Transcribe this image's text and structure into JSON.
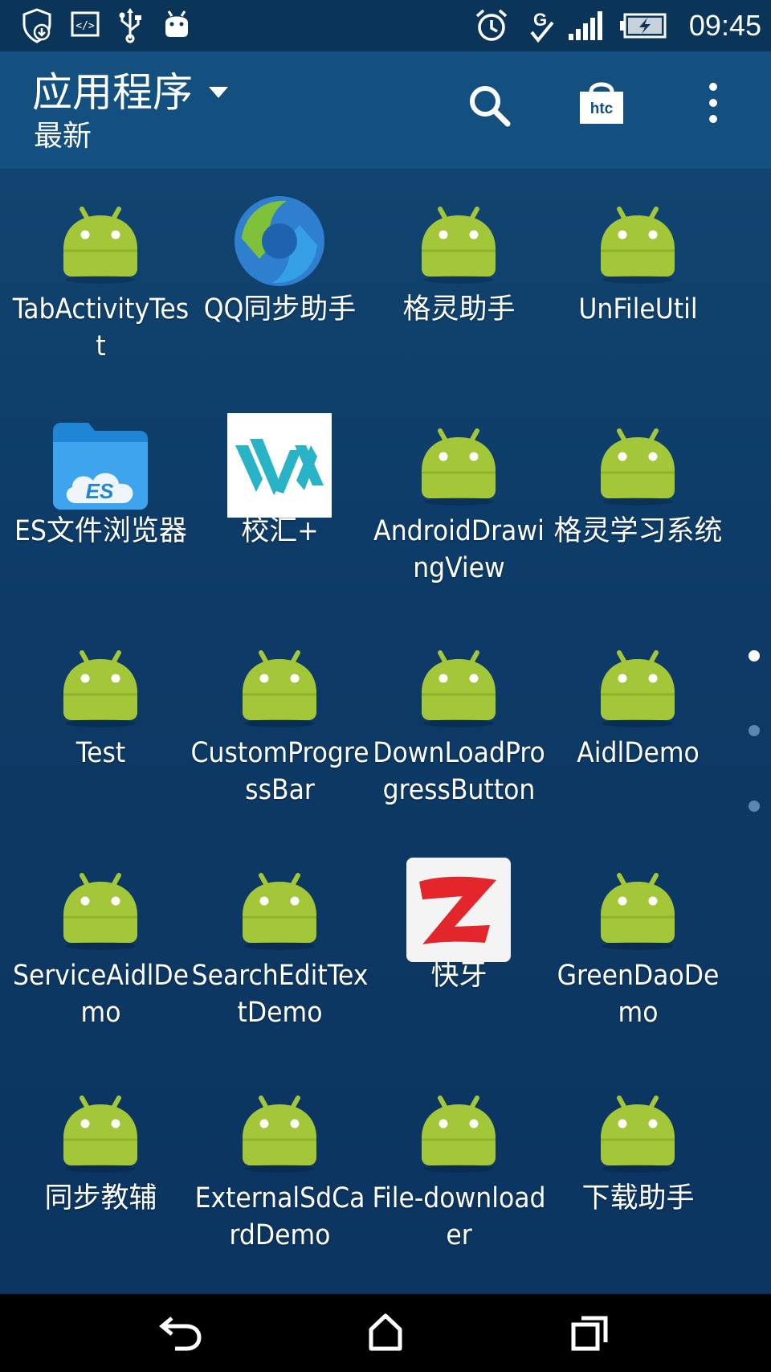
{
  "status_bar": {
    "time": "09:45",
    "left_icons": [
      "shield-download-icon",
      "code-icon",
      "usb-icon",
      "android-debug-icon"
    ],
    "right_icons": [
      "alarm-icon",
      "g-signal-icon",
      "cell-signal-icon",
      "battery-charging-icon"
    ]
  },
  "app_bar": {
    "title": "应用程序",
    "subtitle": "最新",
    "actions": [
      "search-icon",
      "htc-store-icon",
      "more-vert-icon"
    ]
  },
  "apps": [
    {
      "label": "TabActivityTest",
      "icon": "android-icon"
    },
    {
      "label": "QQ同步助手",
      "icon": "qq-sync-icon"
    },
    {
      "label": "格灵助手",
      "icon": "android-icon"
    },
    {
      "label": "UnFileUtil",
      "icon": "android-icon"
    },
    {
      "label": "ES文件浏览器",
      "icon": "es-file-explorer-icon"
    },
    {
      "label": "校汇+",
      "icon": "xiaohui-icon"
    },
    {
      "label": "AndroidDrawingView",
      "icon": "android-icon"
    },
    {
      "label": "格灵学习系统",
      "icon": "android-icon"
    },
    {
      "label": "Test",
      "icon": "android-icon"
    },
    {
      "label": "CustomProgressBar",
      "icon": "android-icon"
    },
    {
      "label": "DownLoadProgressButton",
      "icon": "android-icon"
    },
    {
      "label": "AidlDemo",
      "icon": "android-icon"
    },
    {
      "label": "ServiceAidlDemo",
      "icon": "android-icon"
    },
    {
      "label": "SearchEditTextDemo",
      "icon": "android-icon"
    },
    {
      "label": "快牙",
      "icon": "zapya-icon"
    },
    {
      "label": "GreenDaoDemo",
      "icon": "android-icon"
    },
    {
      "label": "同步教辅",
      "icon": "android-icon"
    },
    {
      "label": "ExternalSdCardDemo",
      "icon": "android-icon"
    },
    {
      "label": "File-downloader",
      "icon": "android-icon"
    },
    {
      "label": "下载助手",
      "icon": "android-icon"
    }
  ],
  "pager": {
    "pages": 3,
    "current": 1
  },
  "nav_bar": {
    "buttons": [
      "back-icon",
      "home-icon",
      "recents-icon"
    ]
  },
  "colors": {
    "android_green": "#a4c639",
    "app_bar": "#13507f",
    "background": "#0e3a63"
  }
}
